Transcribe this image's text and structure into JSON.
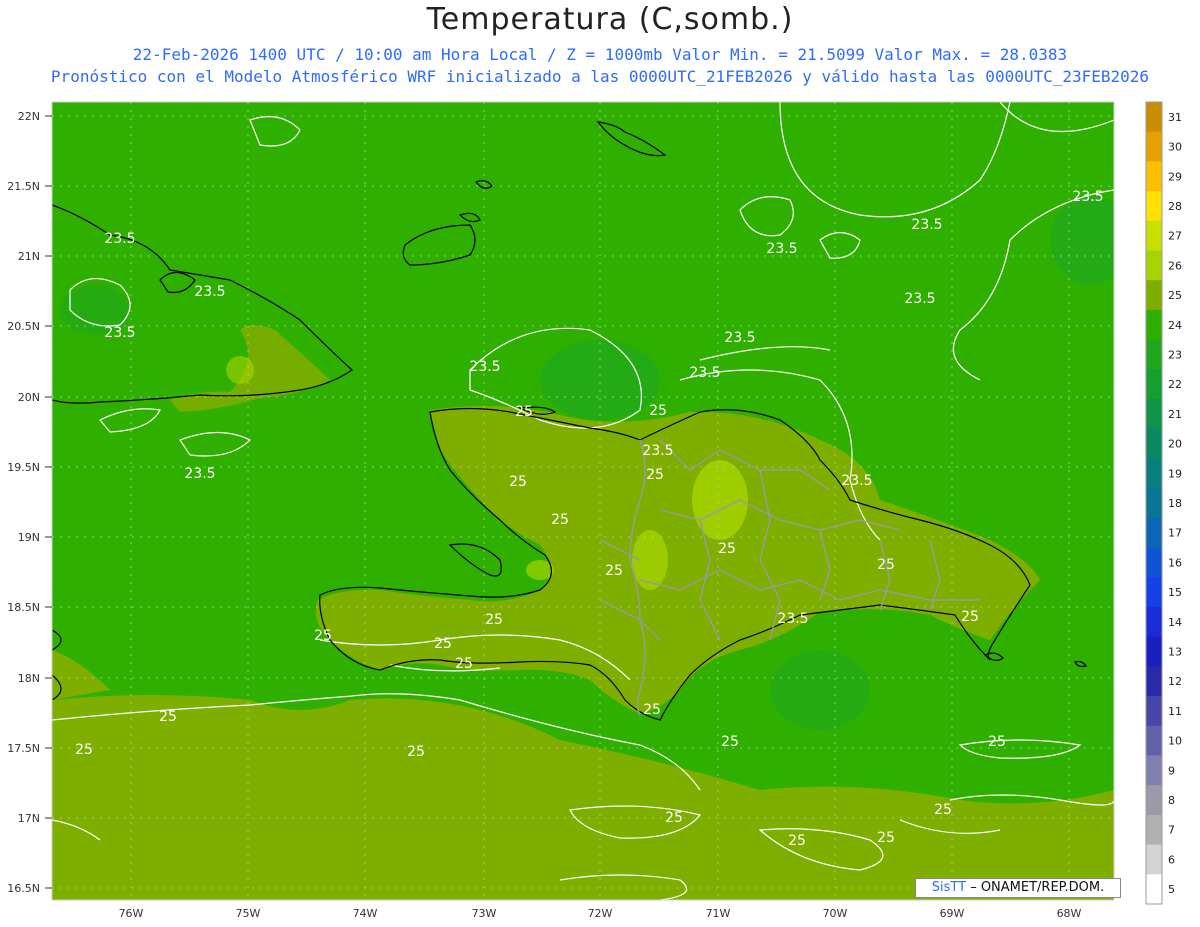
{
  "header": {
    "title": "Temperatura (C,somb.)",
    "subtitle_line1": "22-Feb-2026 1400 UTC / 10:00 am Hora Local / Z = 1000mb  Valor Min. = 21.5099  Valor Max. = 28.0383",
    "subtitle_line2": "Pronóstico con el Modelo Atmosférico WRF inicializado a las 0000UTC_21FEB2026 y válido hasta las  0000UTC_23FEB2026"
  },
  "map": {
    "lat_labels": [
      "22N",
      "21.5N",
      "21N",
      "20.5N",
      "20N",
      "19.5N",
      "19N",
      "18.5N",
      "18N",
      "17.5N",
      "17N",
      "16.5N"
    ],
    "lon_labels": [
      "76W",
      "75W",
      "74W",
      "73W",
      "72W",
      "71W",
      "70W",
      "69W",
      "68W"
    ],
    "contour_labels": [
      "23.5",
      "23.5",
      "23.5",
      "23.5",
      "23.5",
      "23.5",
      "23.5",
      "23.5",
      "23.5",
      "23.5",
      "23.5",
      "23.5",
      "23.5",
      "23.5",
      "25",
      "25",
      "25",
      "25",
      "25",
      "25",
      "25",
      "25",
      "25",
      "25",
      "25",
      "25",
      "25",
      "25",
      "25",
      "25",
      "25",
      "25",
      "25",
      "25",
      "25",
      "25",
      "25"
    ]
  },
  "colorbar": {
    "labels": [
      "31",
      "30",
      "29",
      "28",
      "27",
      "26",
      "25",
      "24",
      "23",
      "22",
      "21",
      "20",
      "19",
      "18",
      "17",
      "16",
      "15",
      "14",
      "13",
      "12",
      "11",
      "10",
      "9",
      "8",
      "7",
      "6",
      "5"
    ],
    "colors": [
      "#c98e00",
      "#e6a100",
      "#ffbf00",
      "#ffe000",
      "#c8e000",
      "#a6d400",
      "#7eae00",
      "#2fb000",
      "#1fa81c",
      "#13a02e",
      "#0e9448",
      "#0a8a62",
      "#08807e",
      "#0a7696",
      "#0c66b8",
      "#1054d6",
      "#1540e8",
      "#1a2cd8",
      "#1c1fc0",
      "#2a2aa8",
      "#4646a8",
      "#6262aa",
      "#8080b0",
      "#9a9aa8",
      "#b0b0b0",
      "#d4d4d4",
      "#ffffff"
    ]
  },
  "credit": {
    "brand": "SisTT",
    "org": " – ONAMET/REP.DOM."
  },
  "colors": {
    "sea_base": "#2fb000",
    "warm_field": "#7eae00",
    "mid_field": "#6aae00",
    "cool_patch": "#1fa81c",
    "coastline": "#000000",
    "contour": "#ffffff",
    "borders": "#9a9a9a",
    "text_blue": "#2f6bff"
  }
}
